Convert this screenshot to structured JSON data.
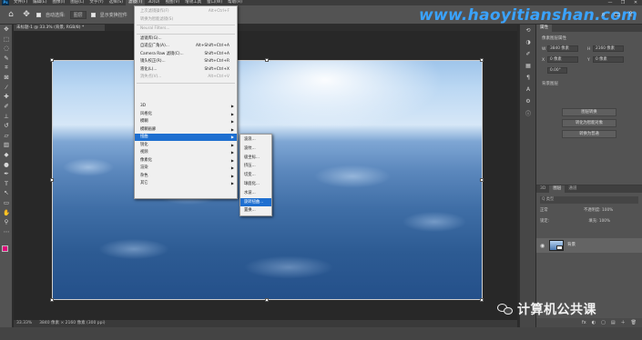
{
  "menubar": {
    "app_icon": "Ps",
    "items": [
      "文件(F)",
      "编辑(E)",
      "图像(I)",
      "图层(L)",
      "文字(Y)",
      "选择(S)",
      "滤镜(T)",
      "3D(D)",
      "视图(V)",
      "增效工具",
      "窗口(W)",
      "帮助(H)"
    ],
    "active_index": 6,
    "window_controls": [
      "—",
      "❐",
      "✕"
    ]
  },
  "optbar": {
    "tool_icon": "move-icon",
    "auto_select_label": "自动选择:",
    "auto_select_value": "图层",
    "transform_label": "显示变换控件",
    "watermark": "www.haoyitianshan.com"
  },
  "doc": {
    "tab_title": "未标题-1 @ 33.3% (背景, RGB/8) *"
  },
  "status": {
    "zoom": "33.33%",
    "size": "3840 像素 × 2160 像素 (300 ppi)"
  },
  "filter_menu": {
    "items": [
      {
        "label": "上次滤镜操作(F)",
        "shortcut": "Alt+Ctrl+F",
        "disabled": true
      },
      {
        "label": "转换为智能滤镜(S)",
        "shortcut": "",
        "disabled": true
      },
      {
        "label": "Neural Filters...",
        "shortcut": "",
        "disabled": true
      },
      {
        "label": "滤镜库(G)...",
        "shortcut": ""
      },
      {
        "label": "自适应广角(A)...",
        "shortcut": "Alt+Shift+Ctrl+A"
      },
      {
        "label": "Camera Raw 滤镜(C)...",
        "shortcut": "Shift+Ctrl+A"
      },
      {
        "label": "镜头校正(R)...",
        "shortcut": "Shift+Ctrl+R"
      },
      {
        "label": "液化(L)...",
        "shortcut": "Shift+Ctrl+X"
      },
      {
        "label": "消失点(V)...",
        "shortcut": "Alt+Ctrl+V",
        "disabled": true
      },
      {
        "label": "3D",
        "sub": true
      },
      {
        "label": "风格化",
        "sub": true
      },
      {
        "label": "模糊",
        "sub": true
      },
      {
        "label": "模糊画廊",
        "sub": true
      },
      {
        "label": "扭曲",
        "sub": true,
        "highlight": true
      },
      {
        "label": "锐化",
        "sub": true
      },
      {
        "label": "视频",
        "sub": true
      },
      {
        "label": "像素化",
        "sub": true
      },
      {
        "label": "渲染",
        "sub": true
      },
      {
        "label": "杂色",
        "sub": true
      },
      {
        "label": "其它",
        "sub": true
      }
    ]
  },
  "distort_submenu": {
    "items": [
      "波浪...",
      "波纹...",
      "极坐标...",
      "挤压...",
      "切变...",
      "球面化...",
      "水波...",
      "旋转扭曲...",
      "置换..."
    ],
    "highlight_index": 7
  },
  "properties": {
    "tabs": [
      "属性"
    ],
    "title": "像素图层属性",
    "w_label": "W",
    "w_value": "3840 像素",
    "h_label": "H",
    "h_value": "2160 像素",
    "x_label": "X",
    "x_value": "0 像素",
    "y_label": "Y",
    "y_value": "0 像素",
    "angle_value": "0.00°",
    "section": "背景图层",
    "buttons": [
      "图层转换",
      "转化为智能对象",
      "转换为普通"
    ]
  },
  "layers": {
    "tabs": [
      "3D",
      "图层",
      "通道"
    ],
    "search_placeholder": "Q 类型",
    "mode": "正常",
    "opacity_label": "不透明度:",
    "opacity_value": "100%",
    "lock_label": "锁定:",
    "fill_label": "填充:",
    "fill_value": "100%",
    "layer_name": "背景",
    "footer_icons": [
      "fx",
      "◐",
      "▢",
      "▤",
      "＋",
      "🗑"
    ]
  },
  "wechat": {
    "label": "计算机公共课"
  },
  "colors": {
    "highlight": "#1e6fd0",
    "fg_swatch": "#e1007a",
    "bg_swatch": "#1020d8"
  }
}
